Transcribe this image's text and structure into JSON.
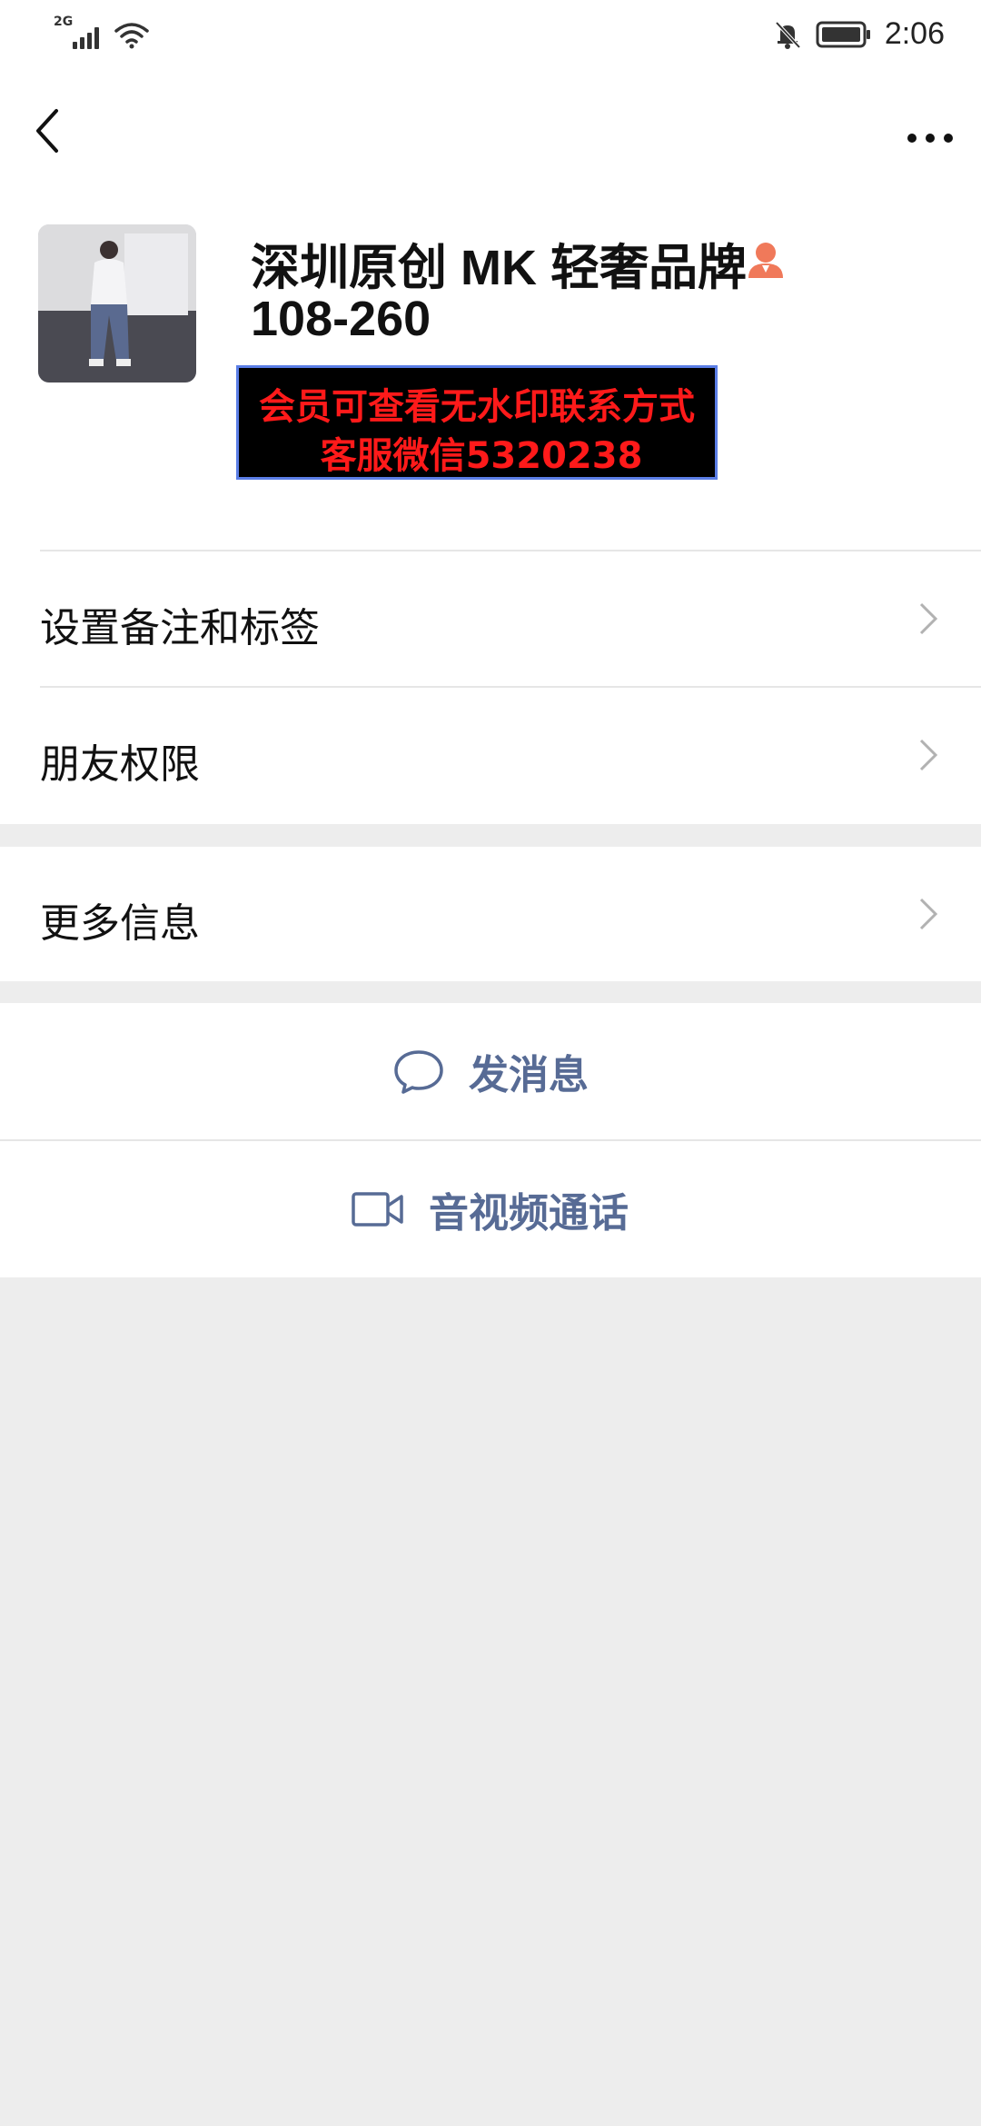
{
  "status_bar": {
    "network_type": "2G",
    "time": "2:06"
  },
  "profile": {
    "name_line1": "深圳原创 MK 轻奢品牌",
    "name_line2": "108-260",
    "watermark_line1": "会员可查看无水印联系方式",
    "watermark_line2": "客服微信5320238",
    "watermark_text_color": "#ff1a1a",
    "corp_icon_color": "#f0795a"
  },
  "menu": {
    "remark_tags": "设置备注和标签",
    "friend_permissions": "朋友权限",
    "more_info": "更多信息"
  },
  "actions": {
    "send_message": "发消息",
    "video_call": "音视频通话",
    "link_color": "#576b95"
  },
  "icons": {
    "back": "back-arrow-icon",
    "more": "more-dots-icon",
    "chevron": "chevron-right-icon",
    "message": "message-bubble-icon",
    "video": "video-camera-icon"
  }
}
